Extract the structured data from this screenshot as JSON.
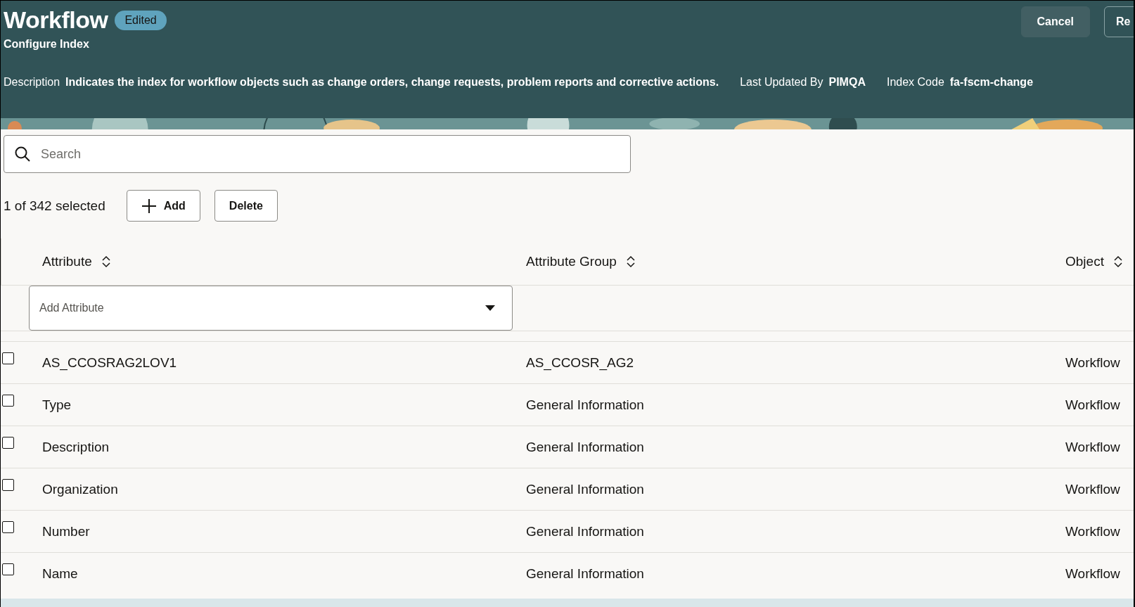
{
  "header": {
    "title": "Workflow",
    "badge": "Edited",
    "subtitle": "Configure Index",
    "buttons": [
      {
        "label": "Cancel",
        "kind": "secondary"
      },
      {
        "label": "Re",
        "kind": "outline"
      }
    ],
    "fields": [
      {
        "label": "Description",
        "value": "Indicates the index for workflow objects such as change orders, change requests, problem reports and corrective actions."
      },
      {
        "label": "Last Updated By",
        "value": "PIMQA"
      },
      {
        "label": "Index Code",
        "value": "fa-fscm-change"
      }
    ]
  },
  "search": {
    "placeholder": "Search"
  },
  "toolbar": {
    "selection": "1 of 342 selected",
    "add": "Add",
    "delete": "Delete"
  },
  "table": {
    "columns": [
      "Attribute",
      "Attribute Group",
      "Object"
    ],
    "add_attribute": {
      "placeholder": "Add Attribute"
    },
    "rows": [
      {
        "attribute": "AS_CCOSRAG2LOV1",
        "group": "AS_CCOSR_AG2",
        "object": "Workflow",
        "checked": false
      },
      {
        "attribute": "Type",
        "group": "General Information",
        "object": "Workflow",
        "checked": false
      },
      {
        "attribute": "Description",
        "group": "General Information",
        "object": "Workflow",
        "checked": false
      },
      {
        "attribute": "Organization",
        "group": "General Information",
        "object": "Workflow",
        "checked": false
      },
      {
        "attribute": "Number",
        "group": "General Information",
        "object": "Workflow",
        "checked": false
      },
      {
        "attribute": "Name",
        "group": "General Information",
        "object": "Workflow",
        "checked": false
      }
    ]
  }
}
